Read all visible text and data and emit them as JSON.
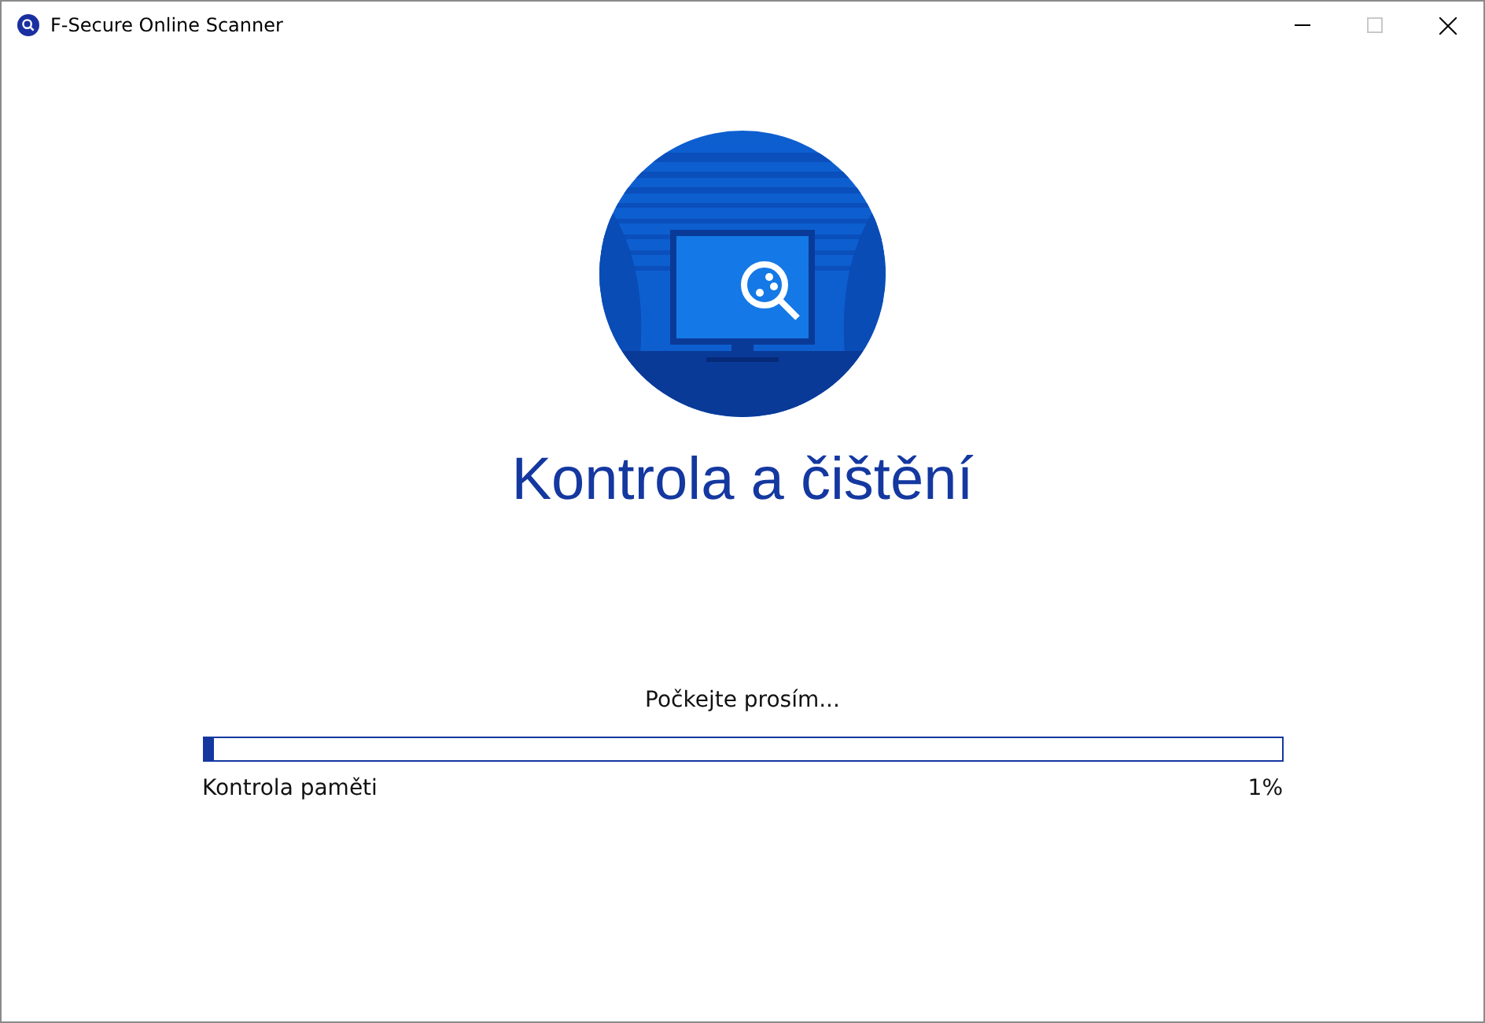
{
  "window": {
    "title": "F-Secure Online Scanner"
  },
  "heading": "Kontrola a čištění",
  "status": "Počkejte prosím...",
  "progress": {
    "level": 0.01,
    "task": "Kontrola paměti",
    "percent": "1%"
  }
}
